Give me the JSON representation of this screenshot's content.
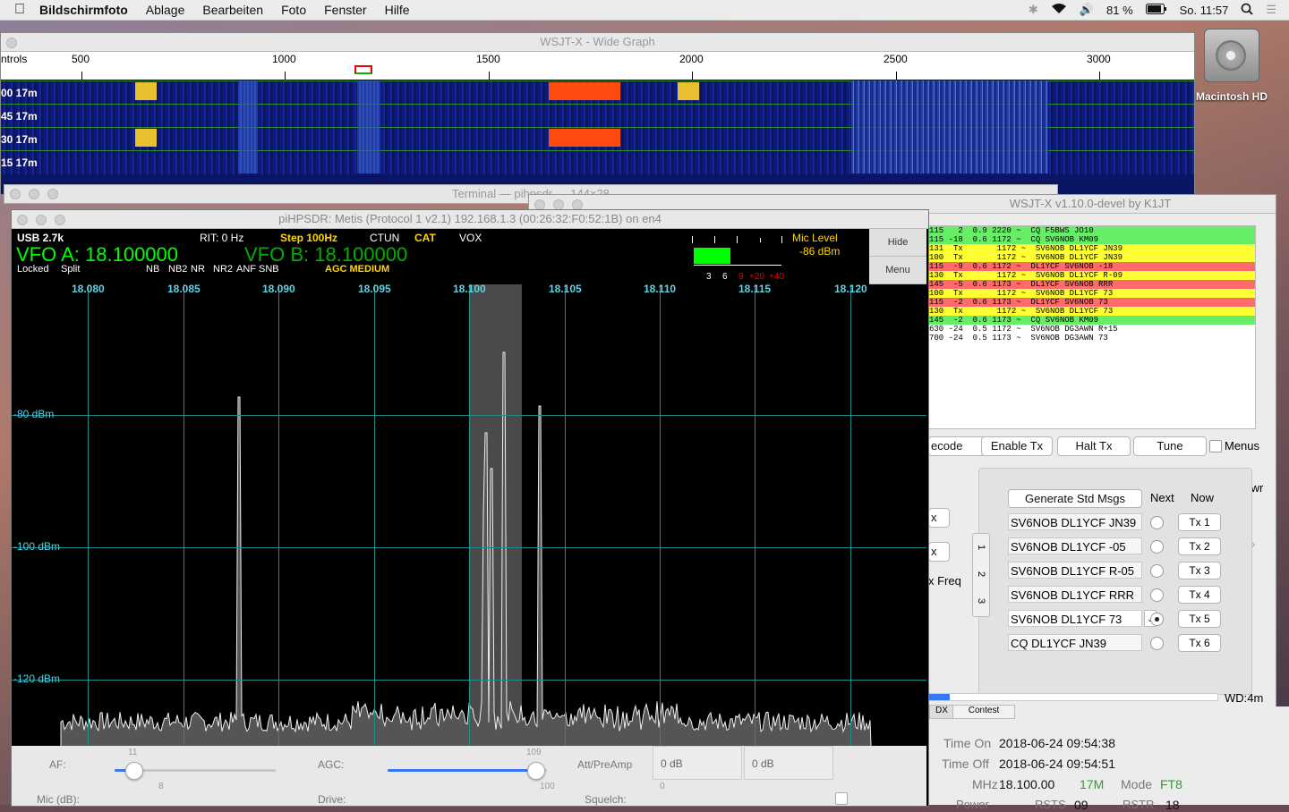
{
  "menubar": {
    "apple": "",
    "app": "Bildschirmfoto",
    "items": [
      "Ablage",
      "Bearbeiten",
      "Foto",
      "Fenster",
      "Hilfe"
    ],
    "battery": "81 %",
    "clock": "So. 11:57"
  },
  "desktop": {
    "drive_label": "Macintosh HD"
  },
  "wide_graph": {
    "title": "WSJT-X - Wide Graph",
    "left_label": "ntrols",
    "scale": [
      "500",
      "1000",
      "1500",
      "2000",
      "2500",
      "3000"
    ],
    "rows": [
      "00  17m",
      "45  17m",
      "30  17m",
      "15  17m"
    ]
  },
  "terminal": {
    "title": "Terminal — pihpsdr — 144×28"
  },
  "wsjt": {
    "title": "WSJT-X   v1.10.0-devel   by K1JT",
    "decodes": [
      {
        "text": "115   2  0.9 2220 ~  CQ F5BWS JO10",
        "color": "#66ee66"
      },
      {
        "text": "115 -18  0.6 1172 ~  CQ SV6NOB KM09",
        "color": "#66ee66"
      },
      {
        "text": "131  Tx       1172 ~  SV6NOB DL1YCF JN39",
        "color": "#ffff33"
      },
      {
        "text": "100  Tx       1172 ~  SV6NOB DL1YCF JN39",
        "color": "#ffff33"
      },
      {
        "text": "115  -9  0.6 1172 ~  DL1YCF SV6NOB -18",
        "color": "#ff6b6b"
      },
      {
        "text": "130  Tx       1172 ~  SV6NOB DL1YCF R-09",
        "color": "#ffff33"
      },
      {
        "text": "145  -5  0.6 1173 ~  DL1YCF SV6NOB RRR",
        "color": "#ff6b6b"
      },
      {
        "text": "100  Tx       1172 ~  SV6NOB DL1YCF 73",
        "color": "#ffff33"
      },
      {
        "text": "115  -2  0.6 1173 ~  DL1YCF SV6NOB 73",
        "color": "#ff6b6b"
      },
      {
        "text": "130  Tx       1172 ~  SV6NOB DL1YCF 73",
        "color": "#ffff33"
      },
      {
        "text": "145  -2  0.6 1173 ~  CQ SV6NOB KM09",
        "color": "#66ee66"
      },
      {
        "text": "630 -24  0.5 1172 ~  SV6NOB DG3AWN R+15",
        "color": "#ffffff"
      },
      {
        "text": "700 -24  0.5 1173 ~  SV6NOB DG3AWN 73",
        "color": "#ffffff"
      }
    ],
    "buttons": {
      "decode": "ecode",
      "enable_tx": "Enable Tx",
      "halt_tx": "Halt Tx",
      "tune": "Tune",
      "menus": "Menus"
    },
    "side": {
      "x1": "x",
      "x2": "x",
      "xfreq": "x Freq"
    },
    "pwr": "Pwr",
    "tabs": [
      "1",
      "2",
      "3"
    ],
    "gen_std": "Generate Std Msgs",
    "next": "Next",
    "now": "Now",
    "messages": [
      {
        "text": "SV6NOB DL1YCF JN39",
        "btn": "Tx 1",
        "checked": false
      },
      {
        "text": "SV6NOB DL1YCF -05",
        "btn": "Tx 2",
        "checked": false
      },
      {
        "text": "SV6NOB DL1YCF R-05",
        "btn": "Tx 3",
        "checked": false
      },
      {
        "text": "SV6NOB DL1YCF RRR",
        "btn": "Tx 4",
        "checked": false
      },
      {
        "text": "SV6NOB DL1YCF 73",
        "btn": "Tx 5",
        "checked": true
      },
      {
        "text": "CQ DL1YCF JN39",
        "btn": "Tx 6",
        "checked": false
      }
    ],
    "wd": "WD:4m",
    "progress": 0.07
  },
  "log": {
    "tabs": [
      "DX",
      "Contest"
    ],
    "time_on_label": "Time On",
    "time_on": "2018-06-24 09:54:38",
    "time_off_label": "Time Off",
    "time_off": "2018-06-24 09:54:51",
    "mhz_label": "MHz",
    "mhz": "18.100.00",
    "band": "17M",
    "mode_label": "Mode",
    "mode": "FT8",
    "power_label": "Power",
    "rsts_label": "RSTS",
    "rsts": "09",
    "rstr_label": "RSTR",
    "rstr": "18"
  },
  "sdr": {
    "title": "piHPSDR: Metis (Protocol 1 v2.1) 192.168.1.3 (00:26:32:F0:52:1B) on en4",
    "mode": "USB 2.7k",
    "rit": "RIT: 0 Hz",
    "step": "Step 100Hz",
    "ctun": "CTUN",
    "cat": "CAT",
    "vox": "VOX",
    "vfo_a": "VFO A: 18.100000",
    "vfo_b": "VFO B: 18.100000",
    "locked": "Locked",
    "split": "Split",
    "flags": [
      "NB",
      "NB2",
      "NR",
      "NR2",
      "ANF",
      "SNB"
    ],
    "agc": "AGC MEDIUM",
    "mic_level_label": "Mic Level",
    "mic_level": "-86 dBm",
    "meter_scale": [
      "3",
      "6",
      "9",
      "+20",
      "+40",
      "+60"
    ],
    "hide": "Hide",
    "menu": "Menu",
    "freq_labels": [
      "18.080",
      "18.085",
      "18.090",
      "18.095",
      "18.100",
      "18.105",
      "18.110",
      "18.115",
      "18.120"
    ],
    "db_labels": [
      "-80 dBm",
      "-100 dBm",
      "-120 dBm"
    ],
    "controls": {
      "af_label": "AF:",
      "af_value": "11",
      "agc_label": "AGC:",
      "agc_value": "109",
      "att_label": "Att/PreAmp",
      "att1": "0 dB",
      "att2": "0 dB",
      "mic_label": "Mic (dB):",
      "mic_value": "8",
      "drive_label": "Drive:",
      "drive_value": "100",
      "squelch_label": "Squelch:",
      "squelch_value": "0"
    }
  }
}
